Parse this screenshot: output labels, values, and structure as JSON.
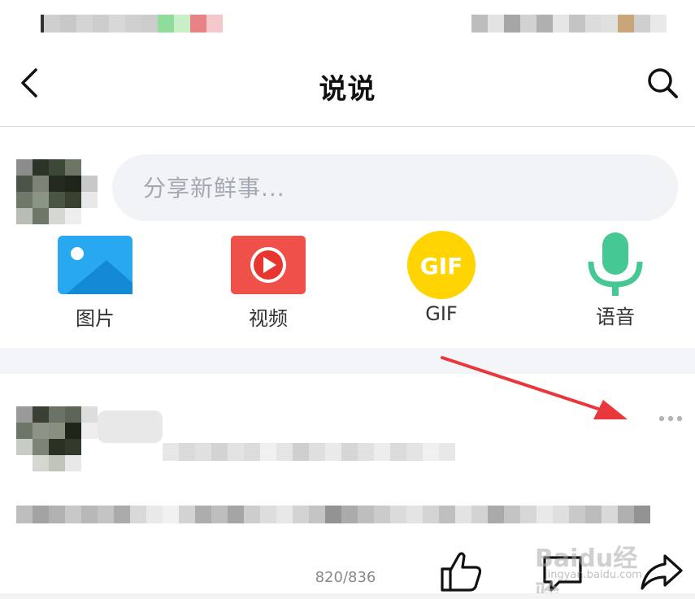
{
  "header": {
    "title": "说说"
  },
  "composer": {
    "placeholder": "分享新鲜事..."
  },
  "media": [
    {
      "label": "图片",
      "icon": "image-icon",
      "color": "#29a8f2"
    },
    {
      "label": "视频",
      "icon": "video-icon",
      "color": "#f0504a"
    },
    {
      "label": "GIF",
      "icon": "gif-icon",
      "color": "#ffd400",
      "icon_text": "GIF"
    },
    {
      "label": "语音",
      "icon": "microphone-icon",
      "color": "#46c895"
    }
  ],
  "post": {
    "counter": "820/836"
  },
  "actions": {
    "like": "like-icon",
    "comment": "comment-icon",
    "share": "share-icon"
  },
  "watermark": {
    "brand": "Baidu经验",
    "url": "jingyan.baidu.com"
  },
  "colors": {
    "annotation_arrow": "#e8383d",
    "input_bg": "#f1f3f7",
    "more_dots": "#b5b5b5"
  }
}
